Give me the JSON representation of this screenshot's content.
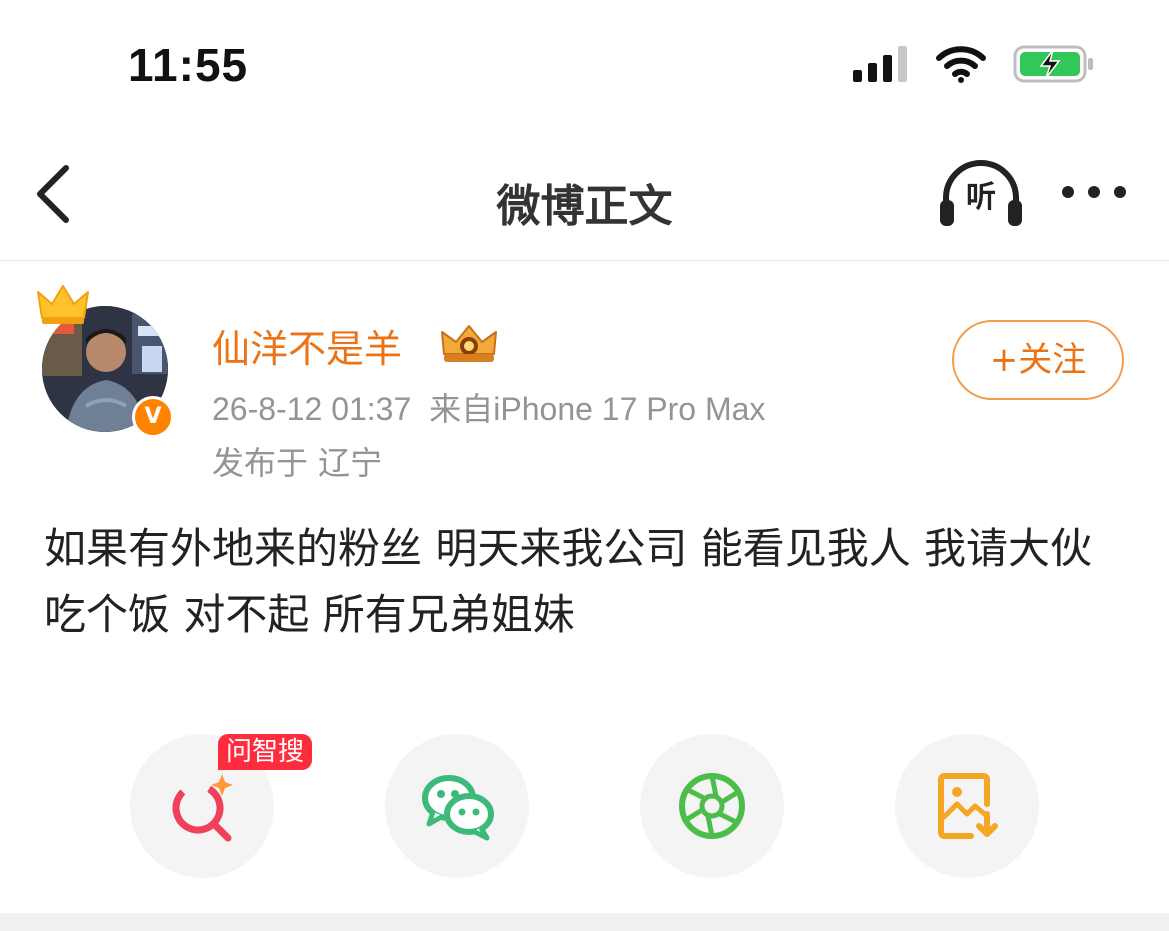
{
  "status_bar": {
    "time": "11:55"
  },
  "nav": {
    "title": "微博正文",
    "listen_label": "听"
  },
  "post": {
    "username": "仙洋不是羊",
    "timestamp": "26-8-12 01:37",
    "source": "来自iPhone 17 Pro Max",
    "location": "发布于 辽宁",
    "follow_label": "+关注",
    "verified_mark": "V",
    "text": "如果有外地来的粉丝 明天来我公司 能看见我人 我请大伙吃个饭 对不起 所有兄弟姐妹"
  },
  "share": {
    "wenzhisou_tag": "问智搜",
    "buttons": [
      {
        "icon": "ai-search-icon",
        "color": "#f0405a"
      },
      {
        "icon": "wechat-icon",
        "color": "#3cba7a"
      },
      {
        "icon": "moments-icon",
        "color": "#4cbc4a"
      },
      {
        "icon": "save-image-icon",
        "color": "#f5a623"
      }
    ]
  },
  "colors": {
    "accent": "#eb7316",
    "meta_text": "#949494",
    "battery": "#33c759"
  }
}
